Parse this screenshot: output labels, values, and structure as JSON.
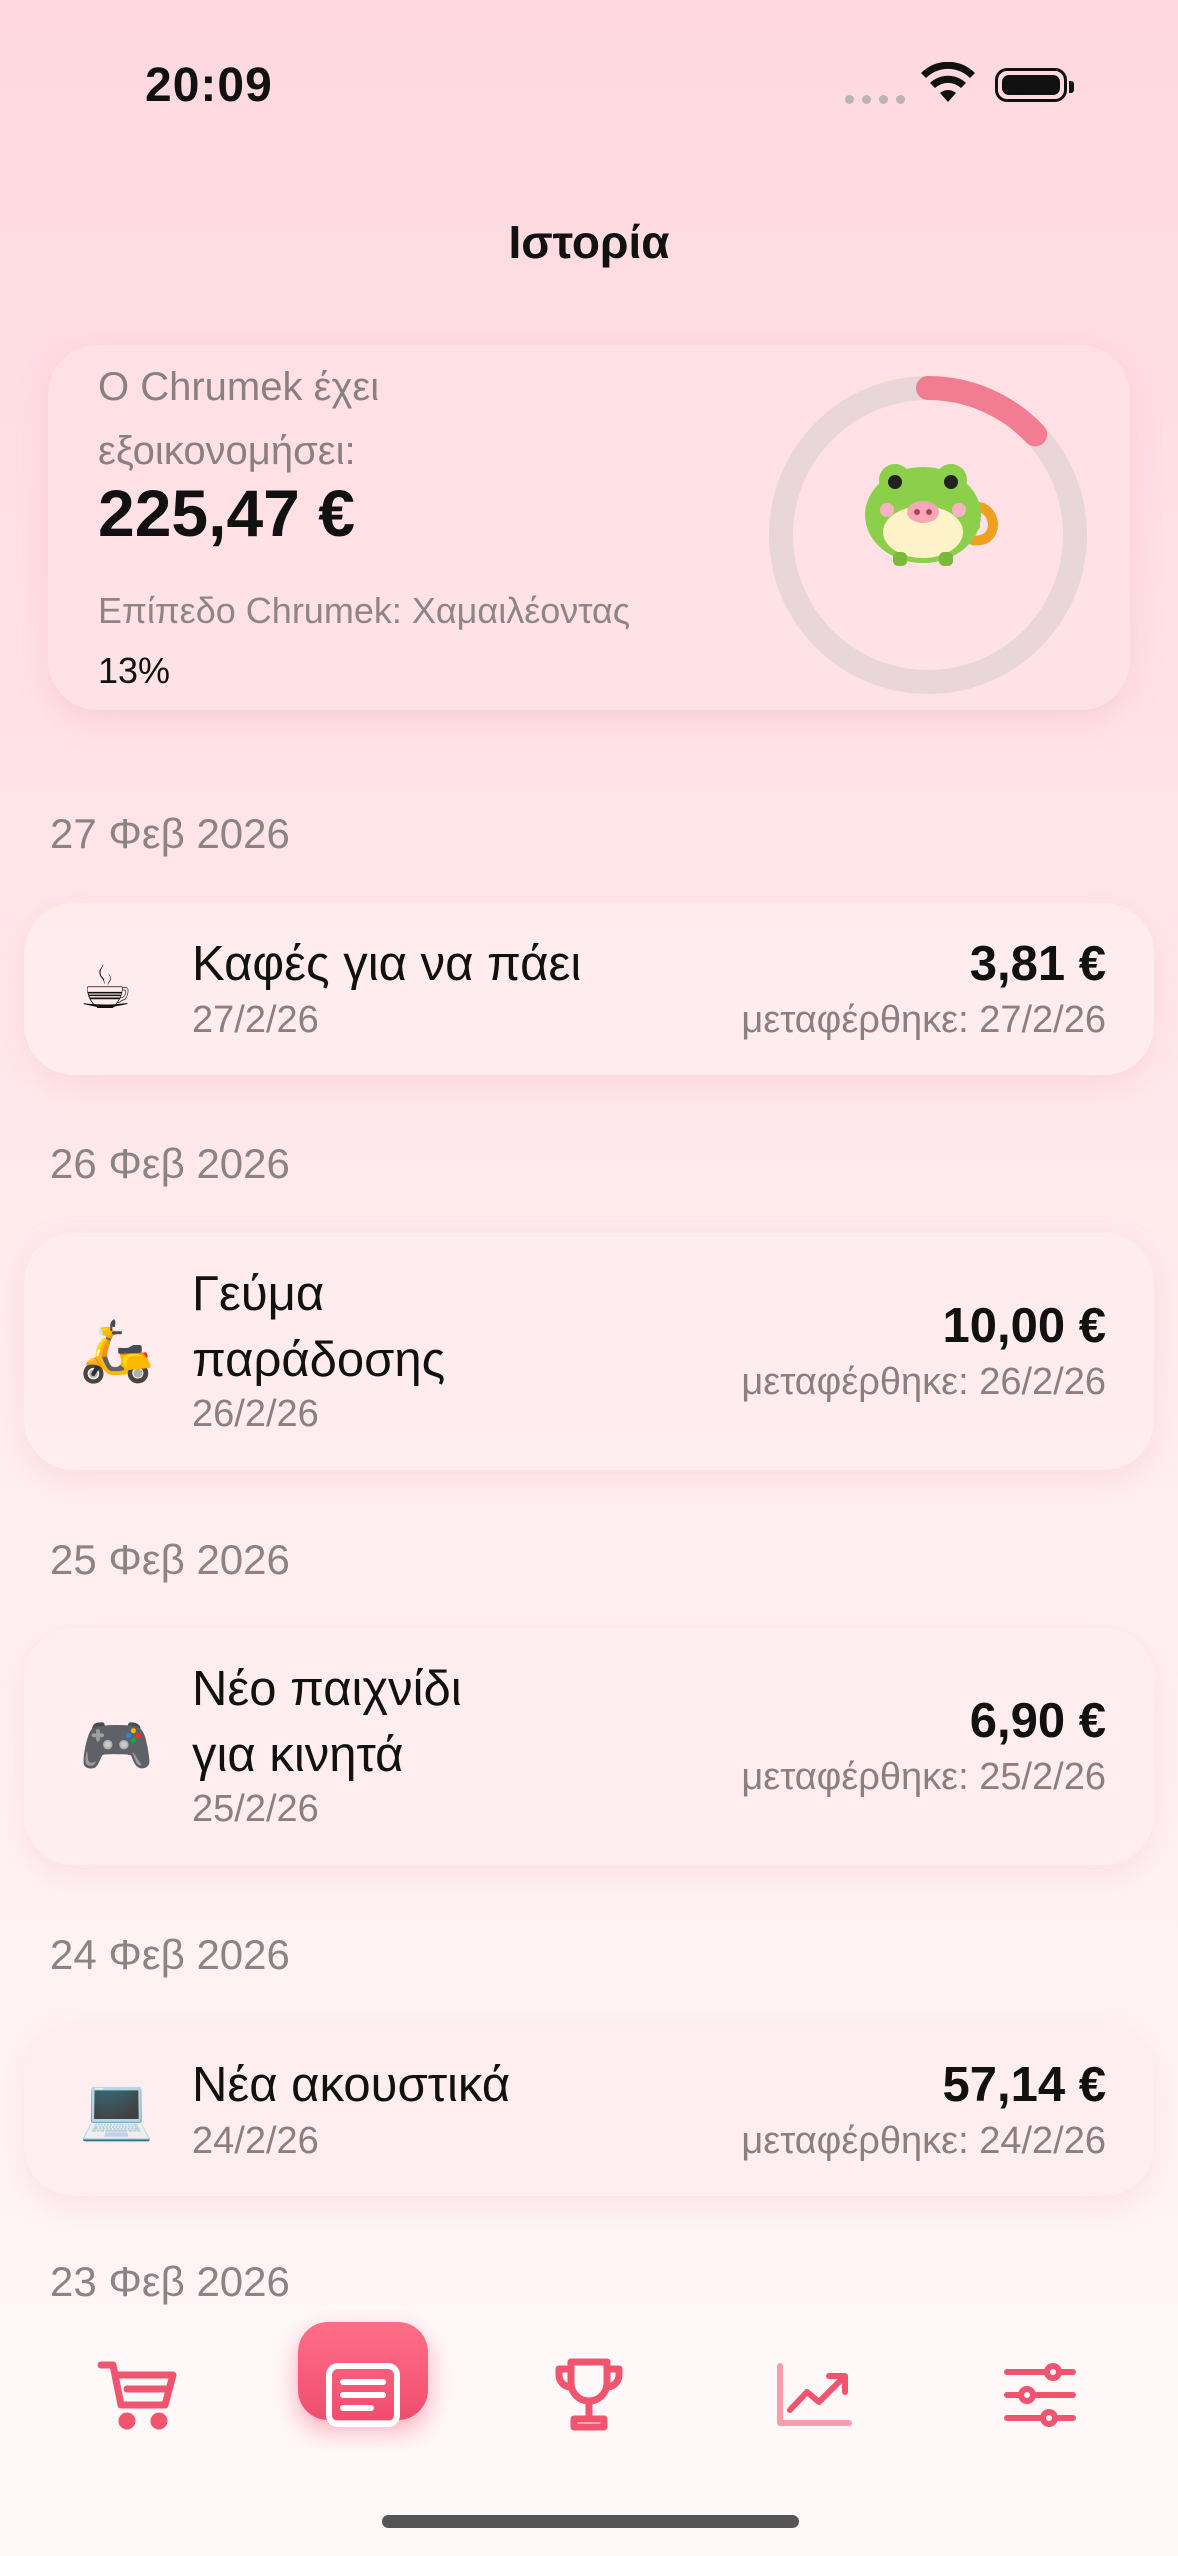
{
  "status": {
    "time": "20:09"
  },
  "page": {
    "title": "Ιστορία"
  },
  "summary": {
    "label": "O Chrumek έχει εξοικονομήσει:",
    "amount": "225,47 €",
    "level": "Επίπεδο Chrumek: Χαμαιλέοντας",
    "percent": "13%",
    "progress": 0.13
  },
  "groups": [
    {
      "date": "27 Φεβ 2026",
      "items": [
        {
          "icon": "coffee-icon",
          "emoji": "☕",
          "title": "Καφές για να πάει",
          "date": "27/2/26",
          "amount": "3,81 €",
          "transferred": "μεταφέρθηκε: 27/2/26"
        }
      ]
    },
    {
      "date": "26 Φεβ 2026",
      "items": [
        {
          "icon": "scooter-icon",
          "emoji": "🛵",
          "title": "Γεύμα παράδοσης",
          "date": "26/2/26",
          "amount": "10,00 €",
          "transferred": "μεταφέρθηκε: 26/2/26"
        }
      ]
    },
    {
      "date": "25 Φεβ 2026",
      "items": [
        {
          "icon": "gamepad-icon",
          "emoji": "🎮",
          "title": "Νέο παιχνίδι για κινητά",
          "date": "25/2/26",
          "amount": "6,90 €",
          "transferred": "μεταφέρθηκε: 25/2/26"
        }
      ]
    },
    {
      "date": "24 Φεβ 2026",
      "items": [
        {
          "icon": "laptop-icon",
          "emoji": "💻",
          "title": "Νέα ακουστικά",
          "date": "24/2/26",
          "amount": "57,14 €",
          "transferred": "μεταφέρθηκε: 24/2/26"
        }
      ]
    }
  ],
  "partial_header": "23 Φεβ 2026",
  "tabs": [
    {
      "icon": "cart-icon",
      "active": false
    },
    {
      "icon": "list-icon",
      "active": true
    },
    {
      "icon": "trophy-icon",
      "active": false
    },
    {
      "icon": "chart-icon",
      "active": false
    },
    {
      "icon": "sliders-icon",
      "active": false
    }
  ],
  "colors": {
    "accent": "#f0546f",
    "ring_track": "#e5d3d6",
    "ring_progress": "#f27d92"
  }
}
